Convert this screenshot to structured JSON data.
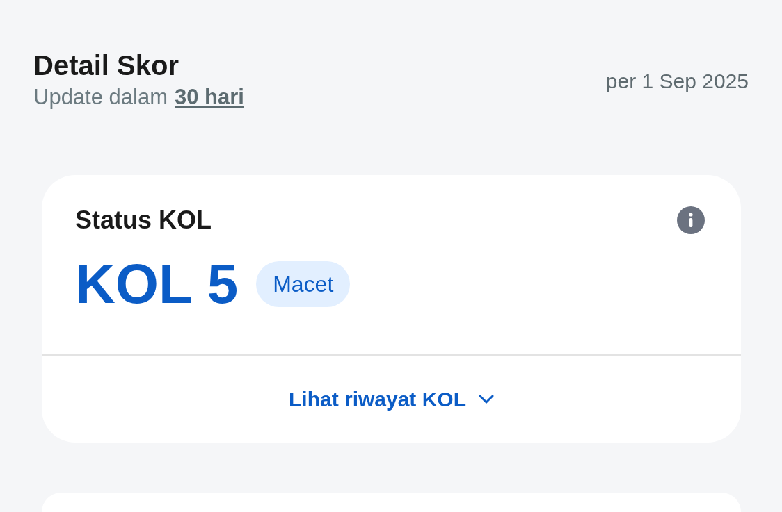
{
  "header": {
    "title": "Detail Skor",
    "subtitle": "Update dalam",
    "subtitle_link": "30 hari",
    "date": "per 1 Sep 2025"
  },
  "status_card": {
    "title": "Status KOL",
    "value": "KOL 5",
    "badge": "Macet",
    "history_link": {
      "label": "Lihat riwayat KOL",
      "expanded": false
    }
  }
}
